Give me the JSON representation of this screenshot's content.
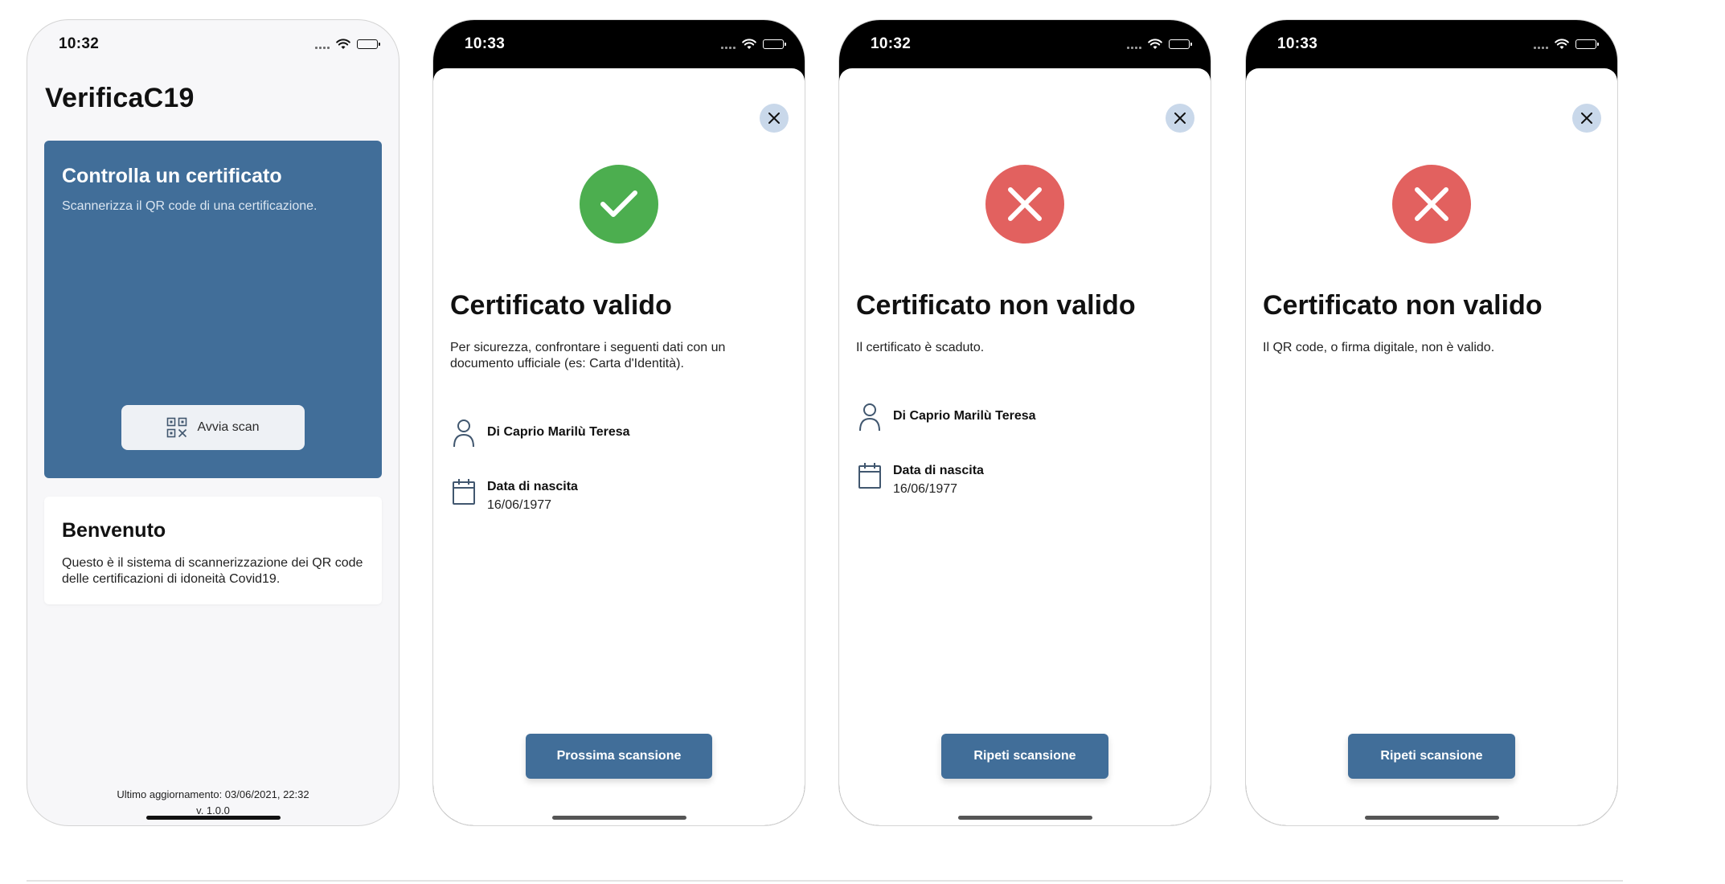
{
  "colors": {
    "primary_blue": "#416e99",
    "success_green": "#4cae4f",
    "error_red": "#e2615f",
    "close_button_bg": "#c9d8ea"
  },
  "home": {
    "time": "10:32",
    "app_title": "VerificaC19",
    "scan_card": {
      "title": "Controlla un certificato",
      "subtitle": "Scannerizza il QR code di una certificazione.",
      "button_label": "Avvia scan",
      "button_icon": "qr-code-icon"
    },
    "welcome_card": {
      "title": "Benvenuto",
      "text": "Questo è il sistema di scannerizzazione dei QR code delle certificazioni di idoneità Covid19."
    },
    "footer": {
      "last_update": "Ultimo aggiornamento: 03/06/2021, 22:32",
      "version": "v. 1.0.0"
    }
  },
  "valid_screen": {
    "time": "10:33",
    "status_icon": "checkmark-icon",
    "title": "Certificato valido",
    "description": "Per sicurezza, confrontare i seguenti dati con un documento ufficiale (es: Carta d'Identità).",
    "holder_name": "Di Caprio Marilù Teresa",
    "birth_label": "Data di nascita",
    "birth_date": "16/06/1977",
    "button_label": "Prossima scansione"
  },
  "expired_screen": {
    "time": "10:32",
    "status_icon": "cross-icon",
    "title": "Certificato non valido",
    "description": "Il certificato è scaduto.",
    "holder_name": "Di Caprio Marilù Teresa",
    "birth_label": "Data di nascita",
    "birth_date": "16/06/1977",
    "button_label": "Ripeti scansione"
  },
  "invalid_screen": {
    "time": "10:33",
    "status_icon": "cross-icon",
    "title": "Certificato non valido",
    "description": "Il QR code, o firma digitale, non è valido.",
    "button_label": "Ripeti scansione"
  }
}
